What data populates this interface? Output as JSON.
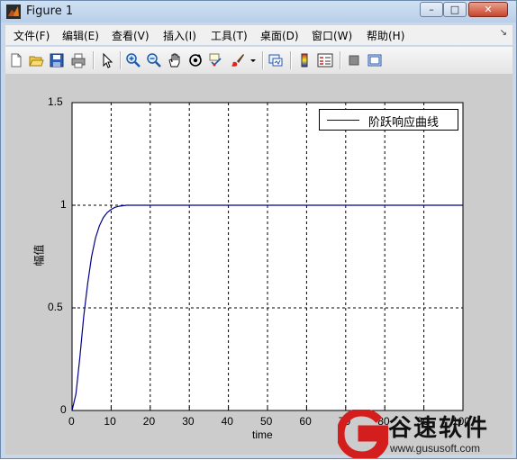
{
  "window": {
    "title": "Figure 1",
    "controls": {
      "minimize": "–",
      "maximize": "□",
      "close": "✕"
    }
  },
  "menubar": {
    "items": [
      "文件(F)",
      "编辑(E)",
      "查看(V)",
      "插入(I)",
      "工具(T)",
      "桌面(D)",
      "窗口(W)",
      "帮助(H)"
    ],
    "overflow_arrow": "↘"
  },
  "toolbar": {
    "buttons": [
      "new-figure-icon",
      "open-file-icon",
      "save-icon",
      "print-icon",
      "pointer-icon",
      "zoom-in-icon",
      "zoom-out-icon",
      "pan-hand-icon",
      "rotate-3d-icon",
      "data-cursor-icon",
      "brush-icon",
      "dropdown-arrow-icon",
      "link-plot-icon",
      "colorbar-icon",
      "legend-icon",
      "hide-plot-tools-icon",
      "show-plot-tools-icon"
    ]
  },
  "chart_data": {
    "type": "line",
    "xlabel": "time",
    "ylabel": "幅值",
    "xlim": [
      0,
      100
    ],
    "ylim": [
      0,
      1.5
    ],
    "x_ticks": [
      "0",
      "10",
      "20",
      "30",
      "40",
      "50",
      "60",
      "70",
      "80",
      "90",
      "100"
    ],
    "y_ticks": [
      "0",
      "0.5",
      "1",
      "1.5"
    ],
    "grid": true,
    "legend_position": "top-right",
    "series": [
      {
        "name": "阶跃响应曲线",
        "color": "#00008b",
        "x": [
          0,
          1,
          2,
          3,
          4,
          5,
          6,
          7,
          8,
          9,
          10,
          11,
          12,
          13,
          14,
          16,
          20,
          30,
          40,
          50,
          60,
          70,
          80,
          90,
          100
        ],
        "y": [
          0,
          0.08,
          0.26,
          0.46,
          0.62,
          0.75,
          0.84,
          0.9,
          0.94,
          0.965,
          0.98,
          0.99,
          0.995,
          0.998,
          1.0,
          1.0,
          1.0,
          1.0,
          1.0,
          1.0,
          1.0,
          1.0,
          1.0,
          1.0,
          1.0
        ]
      }
    ]
  },
  "watermark": {
    "name": "谷速软件",
    "url": "www.gususoft.com"
  }
}
